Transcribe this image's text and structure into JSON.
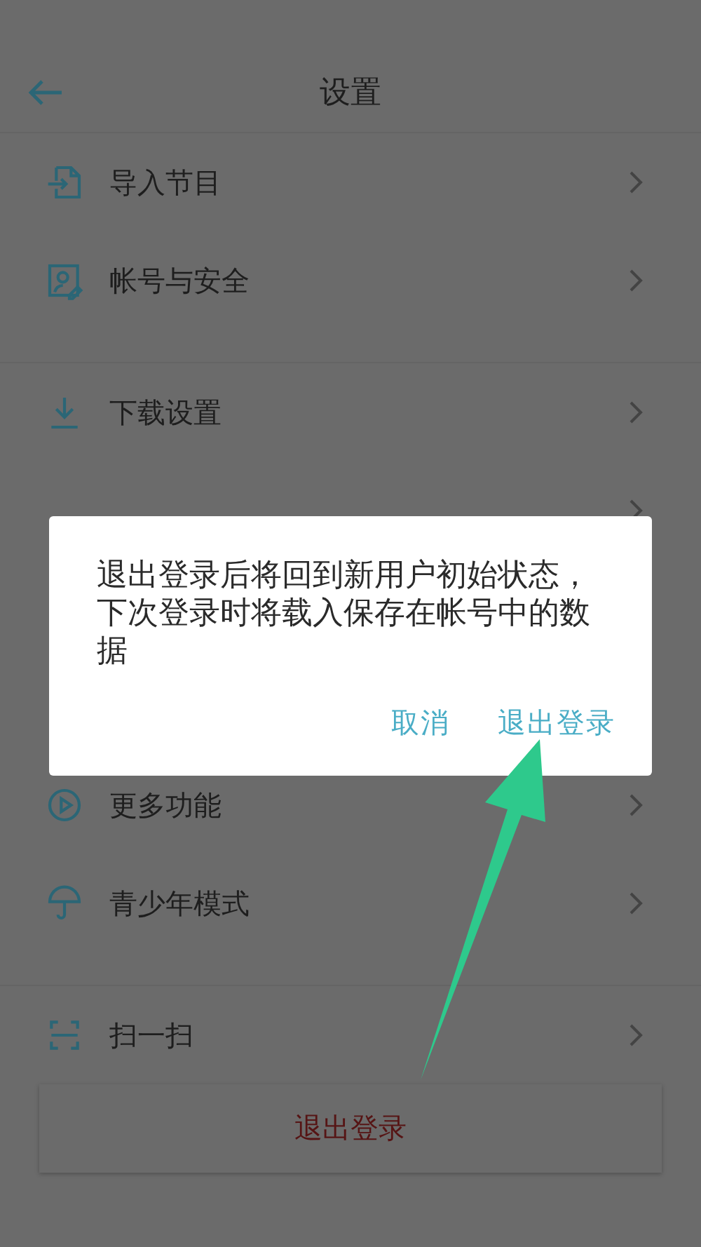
{
  "header": {
    "title": "设置"
  },
  "sections": [
    [
      {
        "kind": "import",
        "label": "导入节目"
      },
      {
        "kind": "account",
        "label": "帐号与安全"
      }
    ],
    [
      {
        "kind": "download",
        "label": "下载设置"
      },
      {
        "kind": "notify"
      }
    ],
    [
      {
        "kind": "more",
        "label": "更多功能"
      },
      {
        "kind": "teen",
        "label": "青少年模式"
      }
    ],
    [
      {
        "kind": "scan",
        "label": "扫一扫"
      }
    ]
  ],
  "logout_button": {
    "label": "退出登录"
  },
  "dialog": {
    "message": "退出登录后将回到新用户初始状态，下次登录时将载入保存在帐号中的数据",
    "buttons": [
      {
        "label": "取消"
      },
      {
        "label": "退出登录"
      }
    ]
  }
}
